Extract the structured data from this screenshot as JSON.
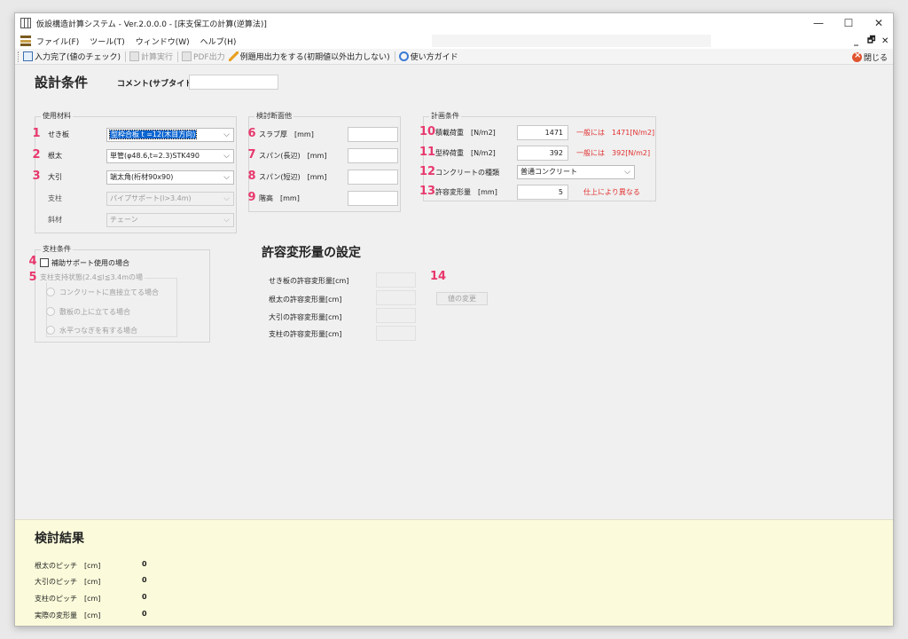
{
  "window": {
    "title": "仮設構造計算システム - Ver.2.0.0.0 - [床支保工の計算(逆算法)]",
    "controls": {
      "minimize": "—",
      "maximize": "☐",
      "close": "✕"
    }
  },
  "menubar": {
    "items": [
      "ファイル(F)",
      "ツール(T)",
      "ウィンドウ(W)",
      "ヘルプ(H)"
    ],
    "mdi_minimize": "_",
    "mdi_restore": "🗗",
    "mdi_close": "✕"
  },
  "toolbar": {
    "input_done": "入力完了(値のチェック)",
    "calc_run": "計算実行",
    "pdf_output": "PDF出力",
    "example_output": "例題用出力をする(初期値以外出力しない)",
    "usage_guide": "使い方ガイド",
    "close": "閉じる"
  },
  "design": {
    "heading": "設計条件",
    "comment_label": "コメント(サブタイトル)",
    "comment_value": ""
  },
  "materials": {
    "title": "使用材料",
    "rows": [
      {
        "badge": "1",
        "label": "せき板",
        "value": "型枠合板 t =12(木目方向)"
      },
      {
        "badge": "2",
        "label": "根太",
        "value": "単管(φ48.6,t=2.3)STK490"
      },
      {
        "badge": "3",
        "label": "大引",
        "value": "端太角(桁材90x90)"
      },
      {
        "badge": "",
        "label": "支柱",
        "value": "パイプサポート(l>3.4m)"
      },
      {
        "badge": "",
        "label": "斜材",
        "value": "チェーン"
      }
    ]
  },
  "section": {
    "title": "検討断面他",
    "rows": [
      {
        "badge": "6",
        "label": "スラブ厚　[mm]",
        "value": ""
      },
      {
        "badge": "7",
        "label": "スパン(長辺)　[mm]",
        "value": ""
      },
      {
        "badge": "8",
        "label": "スパン(短辺)　[mm]",
        "value": ""
      },
      {
        "badge": "9",
        "label": "階高　[mm]",
        "value": ""
      }
    ]
  },
  "plan": {
    "title": "計画条件",
    "rows": [
      {
        "badge": "10",
        "label": "積載荷重　[N/m2]",
        "value": "1471",
        "note": "一般には　1471[N/m2]"
      },
      {
        "badge": "11",
        "label": "型枠荷重　[N/m2]",
        "value": "392",
        "note": "一般には　392[N/m2]"
      },
      {
        "badge": "12",
        "label": "コンクリートの種類",
        "value": "普通コンクリート",
        "note": ""
      },
      {
        "badge": "13",
        "label": "許容変形量　[mm]",
        "value": "5",
        "note": "仕上により異なる"
      }
    ]
  },
  "support": {
    "title": "支柱条件",
    "badge4": "4",
    "checkbox_label": "補助サポート使用の場合",
    "badge5": "5",
    "sub_title": "支柱支持状態(2.4≦l≦3.4mの場",
    "options": [
      "コンクリートに直接立てる場合",
      "敷板の上に立てる場合",
      "水平つなぎを有する場合"
    ]
  },
  "deformation": {
    "heading": "許容変形量の設定",
    "badge": "14",
    "rows": [
      "せき板の許容変形量[cm]",
      "根太の許容変形量[cm]",
      "大引の許容変形量[cm]",
      "支柱の許容変形量[cm]"
    ],
    "change_button": "値の変更"
  },
  "results": {
    "heading": "検討結果",
    "rows": [
      {
        "label": "根太のピッチ　[cm]",
        "value": "0"
      },
      {
        "label": "大引のピッチ　[cm]",
        "value": "0"
      },
      {
        "label": "支柱のピッチ　[cm]",
        "value": "0"
      },
      {
        "label": "実際の変形量　[cm]",
        "value": "0"
      }
    ]
  },
  "colors": {
    "badge": "#e8386d",
    "note": "#e23030",
    "results_bg": "#fbfbdb",
    "selection": "#0a64d0"
  }
}
